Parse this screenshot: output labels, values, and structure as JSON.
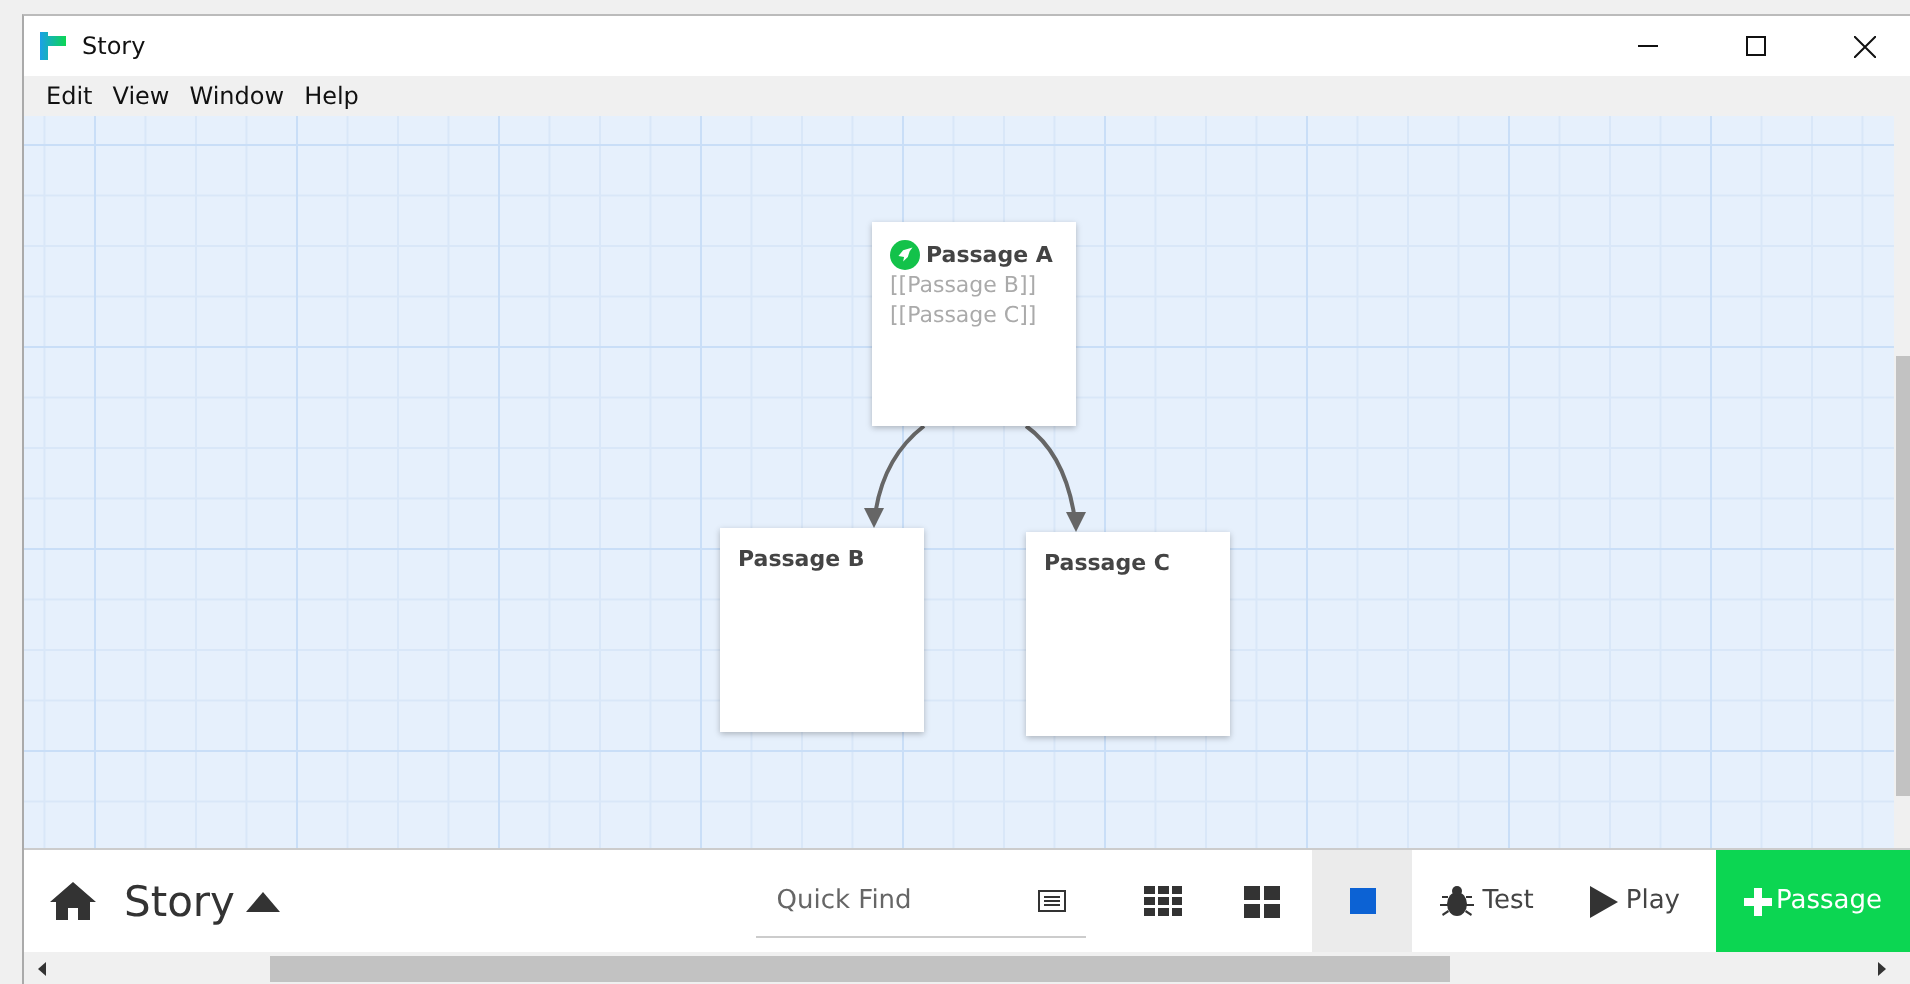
{
  "window": {
    "title": "Story"
  },
  "menu": [
    "Edit",
    "View",
    "Window",
    "Help"
  ],
  "passages": [
    {
      "name": "Passage A",
      "start": true,
      "excerpt": [
        "[[Passage B]]",
        "[[Passage C]]"
      ]
    },
    {
      "name": "Passage B",
      "start": false
    },
    {
      "name": "Passage C",
      "start": false
    }
  ],
  "toolbar": {
    "story_title": "Story",
    "quick_find": {
      "placeholder": "Quick Find"
    },
    "zoom_buttons": [
      {
        "kind": "small",
        "selected": false
      },
      {
        "kind": "medium",
        "selected": false
      },
      {
        "kind": "large",
        "selected": true
      }
    ],
    "test": "Test",
    "play": "Play",
    "add": "Passage"
  }
}
